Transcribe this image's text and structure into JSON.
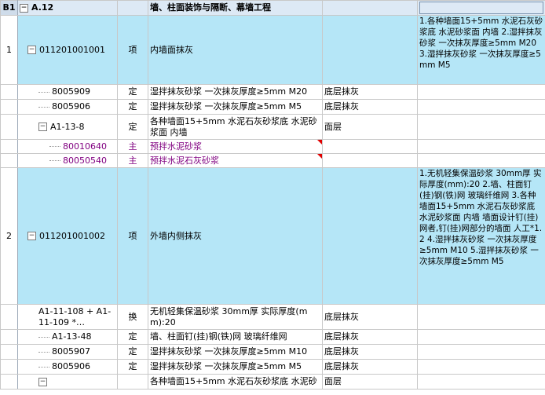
{
  "header": {
    "corner": "B1",
    "code": "A.12",
    "name": "墙、柱面装饰与隔断、幕墙工程"
  },
  "rows": [
    {
      "seq": "1",
      "code": "011201001001",
      "type": "项",
      "name": "内墙面抹灰",
      "part": "",
      "desc": "1.各种墙面15+5mm 水泥石灰砂浆底 水泥砂浆面 内墙\n2.湿拌抹灰砂浆 一次抹灰厚度≥5mm M20\n3.湿拌抹灰砂浆 一次抹灰厚度≥5mm M5"
    },
    {
      "code": "8005909",
      "type": "定",
      "name": "湿拌抹灰砂浆 一次抹灰厚度≥5mm M20",
      "part": "底层抹灰"
    },
    {
      "code": "8005906",
      "type": "定",
      "name": "湿拌抹灰砂浆 一次抹灰厚度≥5mm M5",
      "part": "底层抹灰"
    },
    {
      "code": "A1-13-8",
      "type": "定",
      "name": "各种墙面15+5mm 水泥石灰砂浆底 水泥砂浆面 内墙",
      "part": "面层"
    },
    {
      "code": "80010640",
      "type": "主",
      "name": "预拌水泥砂浆",
      "part": ""
    },
    {
      "code": "80050540",
      "type": "主",
      "name": "预拌水泥石灰砂浆",
      "part": ""
    },
    {
      "seq": "2",
      "code": "011201001002",
      "type": "项",
      "name": "外墙内侧抹灰",
      "part": "",
      "desc": "1.无机轻集保温砂浆 30mm厚 实际厚度(mm):20\n2.墙、柱面钉(挂)钢(铁)网 玻璃纤维网\n3.各种墙面15+5mm 水泥石灰砂浆底 水泥砂浆面 内墙 墙面设计钉(挂)网者,钉(挂)网部分的墙面 人工*1.2\n4.湿拌抹灰砂浆 一次抹灰厚度≥5mm M10\n5.湿拌抹灰砂浆 一次抹灰厚度≥5mm M5"
    },
    {
      "code": "A1-11-108 + A1-11-109 *…",
      "type": "换",
      "name": "无机轻集保温砂浆 30mm厚 实际厚度(mm):20",
      "part": "底层抹灰"
    },
    {
      "code": "A1-13-48",
      "type": "定",
      "name": "墙、柱面钉(挂)钢(铁)网 玻璃纤维网",
      "part": "底层抹灰"
    },
    {
      "code": "8005907",
      "type": "定",
      "name": "湿拌抹灰砂浆 一次抹灰厚度≥5mm M10",
      "part": "底层抹灰"
    },
    {
      "code": "8005906",
      "type": "定",
      "name": "湿拌抹灰砂浆 一次抹灰厚度≥5mm M5",
      "part": "底层抹灰"
    },
    {
      "code": "",
      "type": "",
      "name": "各种墙面15+5mm 水泥石灰砂浆底 水泥砂",
      "part": "面层"
    }
  ],
  "tree_toggle": {
    "collapse": "−"
  }
}
